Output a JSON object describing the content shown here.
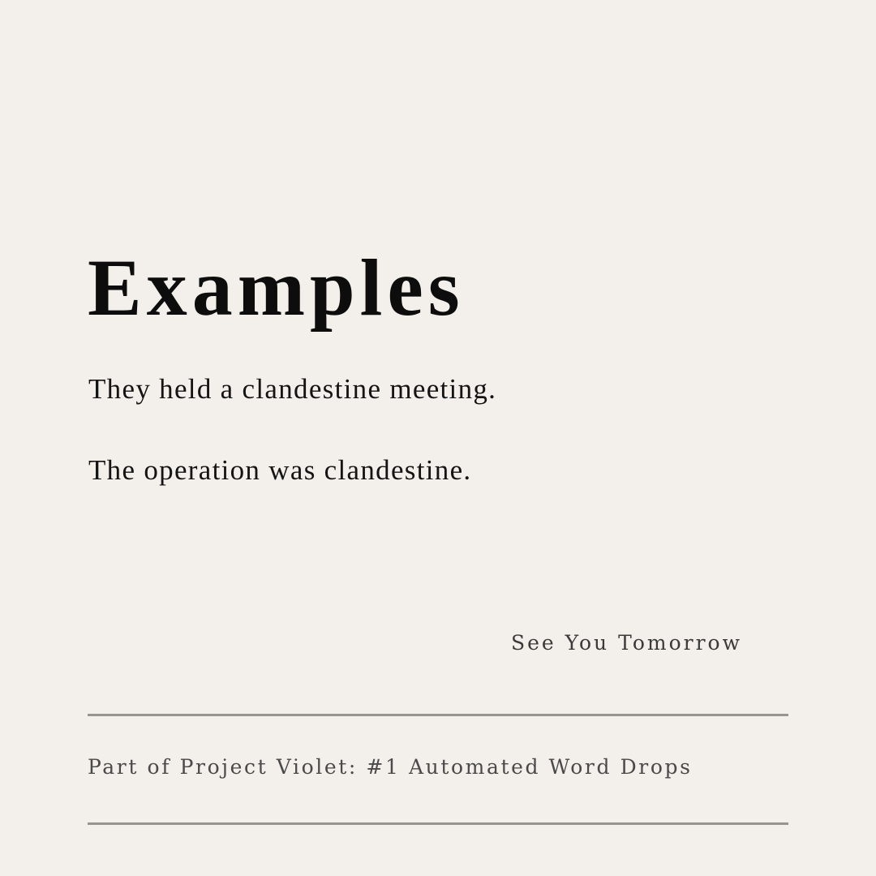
{
  "heading": "Examples",
  "examples": [
    "They held a clandestine meeting.",
    "The operation was clandestine."
  ],
  "signoff": "See You Tomorrow",
  "footer": "Part of Project Violet: #1 Automated Word Drops",
  "colors": {
    "background": "#f3f0eb",
    "text": "#0d0d0d",
    "muted_text": "#4a4a4a",
    "rule": "#989591"
  }
}
